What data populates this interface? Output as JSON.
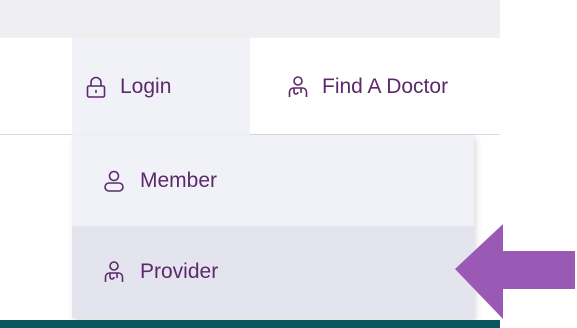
{
  "nav": {
    "login_label": "Login",
    "find_doctor_label": "Find A Doctor"
  },
  "dropdown": {
    "items": [
      {
        "label": "Member",
        "icon": "user-icon"
      },
      {
        "label": "Provider",
        "icon": "provider-icon"
      }
    ]
  },
  "colors": {
    "text": "#5b2a6a",
    "menu_bg": "#f1f2f8",
    "selected_bg": "#e3e4ed",
    "arrow": "#9b59b6",
    "bottom_band": "#0a5660"
  }
}
